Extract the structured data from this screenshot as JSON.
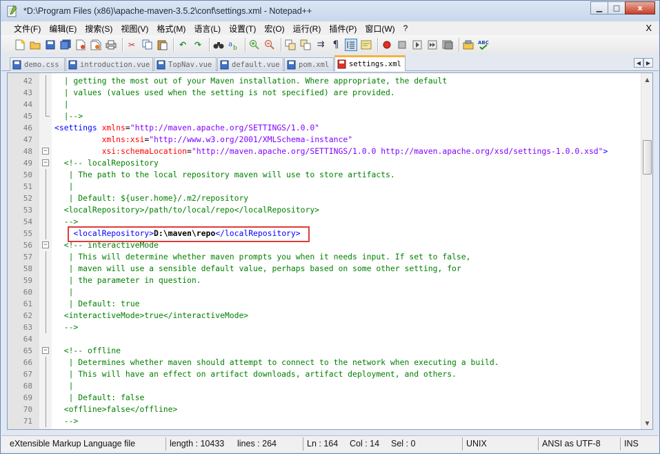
{
  "window": {
    "title": "*D:\\Program Files (x86)\\apache-maven-3.5.2\\conf\\settings.xml - Notepad++",
    "minimize_icon": "minimize-icon",
    "maximize_icon": "maximize-icon",
    "close_label": "x"
  },
  "menu": {
    "items": [
      "文件(F)",
      "编辑(E)",
      "搜索(S)",
      "视图(V)",
      "格式(M)",
      "语言(L)",
      "设置(T)",
      "宏(O)",
      "运行(R)",
      "插件(P)",
      "窗口(W)",
      "?"
    ],
    "close_label": "X"
  },
  "tabs": [
    {
      "label": "demo.css",
      "active": false
    },
    {
      "label": "introduction.vue",
      "active": false
    },
    {
      "label": "TopNav.vue",
      "active": false
    },
    {
      "label": "default.vue",
      "active": false
    },
    {
      "label": "pom.xml",
      "active": false
    },
    {
      "label": "settings.xml",
      "active": true
    }
  ],
  "editor": {
    "lines": [
      {
        "n": "42",
        "segs": [
          [
            "c-com",
            "  | getting the most out of your Maven installation. Where appropriate, the default"
          ]
        ]
      },
      {
        "n": "43",
        "segs": [
          [
            "c-com",
            "  | values (values used when the setting is not specified) are provided."
          ]
        ]
      },
      {
        "n": "44",
        "segs": [
          [
            "c-com",
            "  |"
          ]
        ]
      },
      {
        "n": "45",
        "segs": [
          [
            "c-com",
            "  |-->"
          ]
        ]
      },
      {
        "n": "46",
        "segs": [
          [
            "c-tag",
            "<settings "
          ],
          [
            "c-attr",
            "xmlns"
          ],
          [
            "c-txt",
            "="
          ],
          [
            "c-val",
            "\"http://maven.apache.org/SETTINGS/1.0.0\""
          ]
        ]
      },
      {
        "n": "47",
        "segs": [
          [
            "c-txt",
            "          "
          ],
          [
            "c-attr",
            "xmlns:xsi"
          ],
          [
            "c-txt",
            "="
          ],
          [
            "c-val",
            "\"http://www.w3.org/2001/XMLSchema-instance\""
          ]
        ]
      },
      {
        "n": "48",
        "segs": [
          [
            "c-txt",
            "          "
          ],
          [
            "c-attr",
            "xsi:schemaLocation"
          ],
          [
            "c-txt",
            "="
          ],
          [
            "c-val",
            "\"http://maven.apache.org/SETTINGS/1.0.0 http://maven.apache.org/xsd/settings-1.0.0.xsd\""
          ],
          [
            "c-tag",
            ">"
          ]
        ]
      },
      {
        "n": "49",
        "segs": [
          [
            "c-com",
            "  <!-- localRepository"
          ]
        ]
      },
      {
        "n": "50",
        "segs": [
          [
            "c-com",
            "   | The path to the local repository maven will use to store artifacts."
          ]
        ]
      },
      {
        "n": "51",
        "segs": [
          [
            "c-com",
            "   |"
          ]
        ]
      },
      {
        "n": "52",
        "segs": [
          [
            "c-com",
            "   | Default: ${user.home}/.m2/repository"
          ]
        ]
      },
      {
        "n": "53",
        "segs": [
          [
            "c-com",
            "  <localRepository>/path/to/local/repo</localRepository>"
          ]
        ]
      },
      {
        "n": "54",
        "segs": [
          [
            "c-com",
            "  -->"
          ]
        ]
      },
      {
        "n": "55",
        "segs": [
          [
            "c-txt",
            "    "
          ],
          [
            "c-tag",
            "<localRepository>"
          ],
          [
            "c-strong",
            "D:\\maven\\repo"
          ],
          [
            "c-tag",
            "</localRepository>"
          ]
        ]
      },
      {
        "n": "56",
        "segs": [
          [
            "c-com",
            "  <!-- interactiveMode"
          ]
        ]
      },
      {
        "n": "57",
        "segs": [
          [
            "c-com",
            "   | This will determine whether maven prompts you when it needs input. If set to false,"
          ]
        ]
      },
      {
        "n": "58",
        "segs": [
          [
            "c-com",
            "   | maven will use a sensible default value, perhaps based on some other setting, for"
          ]
        ]
      },
      {
        "n": "59",
        "segs": [
          [
            "c-com",
            "   | the parameter in question."
          ]
        ]
      },
      {
        "n": "60",
        "segs": [
          [
            "c-com",
            "   |"
          ]
        ]
      },
      {
        "n": "61",
        "segs": [
          [
            "c-com",
            "   | Default: true"
          ]
        ]
      },
      {
        "n": "62",
        "segs": [
          [
            "c-com",
            "  <interactiveMode>true</interactiveMode>"
          ]
        ]
      },
      {
        "n": "63",
        "segs": [
          [
            "c-com",
            "  -->"
          ]
        ]
      },
      {
        "n": "64",
        "segs": [
          [
            "c-txt",
            ""
          ]
        ]
      },
      {
        "n": "65",
        "segs": [
          [
            "c-com",
            "  <!-- offline"
          ]
        ]
      },
      {
        "n": "66",
        "segs": [
          [
            "c-com",
            "   | Determines whether maven should attempt to connect to the network when executing a build."
          ]
        ]
      },
      {
        "n": "67",
        "segs": [
          [
            "c-com",
            "   | This will have an effect on artifact downloads, artifact deployment, and others."
          ]
        ]
      },
      {
        "n": "68",
        "segs": [
          [
            "c-com",
            "   |"
          ]
        ]
      },
      {
        "n": "69",
        "segs": [
          [
            "c-com",
            "   | Default: false"
          ]
        ]
      },
      {
        "n": "70",
        "segs": [
          [
            "c-com",
            "  <offline>false</offline>"
          ]
        ]
      },
      {
        "n": "71",
        "segs": [
          [
            "c-com",
            "  -->"
          ]
        ]
      }
    ],
    "fold_markers": {
      "48": "minus",
      "49": "minus",
      "56": "minus",
      "65": "minus"
    }
  },
  "status": {
    "filetype": "eXtensible Markup Language file",
    "length": "length : 10433",
    "lines": "lines : 264",
    "ln": "Ln : 164",
    "col": "Col : 14",
    "sel": "Sel : 0",
    "eol": "UNIX",
    "encoding": "ANSI as UTF-8",
    "mode": "INS"
  },
  "colors": {
    "comment": "#008000",
    "tag": "#0000ff",
    "attribute": "#ff0000",
    "value": "#8000ff",
    "highlight_box": "#e03a3a",
    "active_tab_accent": "#f6b23c"
  }
}
